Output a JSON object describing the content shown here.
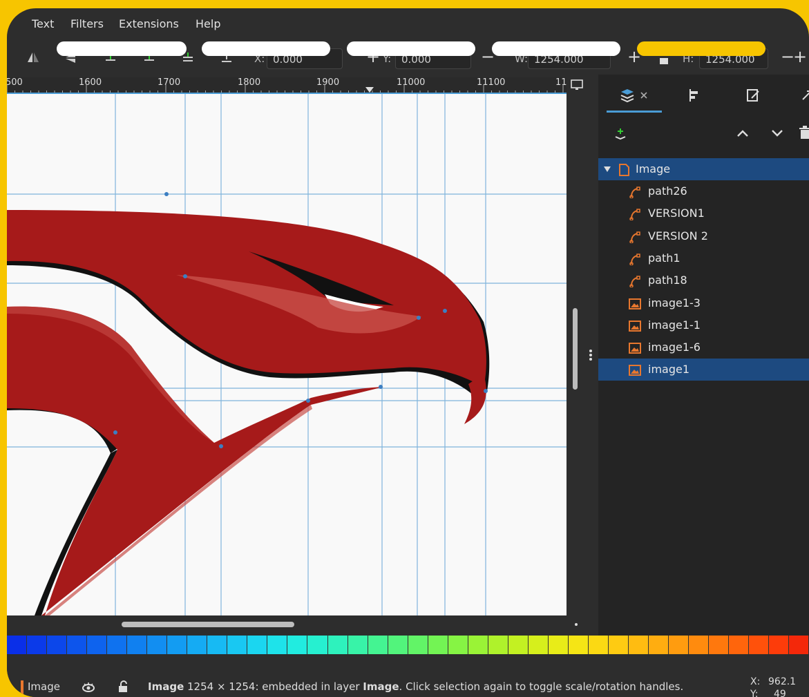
{
  "menu": {
    "items": [
      "Text",
      "Filters",
      "Extensions",
      "Help"
    ]
  },
  "toolbar": {
    "x_label": "X:",
    "x_value": "0.000",
    "y_label": "Y:",
    "y_value": "0.000",
    "w_label": "W:",
    "w_value": "1254.000",
    "h_label": "H:",
    "h_value": "1254.000",
    "minus": "−",
    "plus": "+"
  },
  "ruler": {
    "labels": [
      "500",
      "1600",
      "1700",
      "1800",
      "1900",
      "11000",
      "11100",
      "11"
    ]
  },
  "layers_panel": {
    "root": "Image",
    "items": [
      {
        "label": "path26",
        "kind": "path"
      },
      {
        "label": "VERSION1",
        "kind": "path"
      },
      {
        "label": "VERSION 2",
        "kind": "path"
      },
      {
        "label": "path1",
        "kind": "path"
      },
      {
        "label": "path18",
        "kind": "path"
      },
      {
        "label": "image1-3",
        "kind": "image"
      },
      {
        "label": "image1-1",
        "kind": "image"
      },
      {
        "label": "image1-6",
        "kind": "image"
      },
      {
        "label": "image1",
        "kind": "image",
        "selected": true
      }
    ]
  },
  "palette": [
    "#0a2fe8",
    "#0b3ae9",
    "#0c47ea",
    "#0d55ec",
    "#0e63ee",
    "#0f72ef",
    "#1080f0",
    "#128ef1",
    "#139cf2",
    "#15abf3",
    "#17baf3",
    "#19c8f2",
    "#1bd6f0",
    "#1ee3ea",
    "#21ece0",
    "#26f0d0",
    "#2ef2bd",
    "#38f3a8",
    "#44f492",
    "#52f47c",
    "#62f467",
    "#73f454",
    "#86f444",
    "#9af336",
    "#aff22b",
    "#c3f122",
    "#d6ef1c",
    "#e8ec18",
    "#f5e515",
    "#fbd913",
    "#fecb12",
    "#ffbc11",
    "#ffad10",
    "#ff9c0f",
    "#ff8b0e",
    "#ff780d",
    "#ff650c",
    "#ff510b",
    "#fd3c0a",
    "#f4280a"
  ],
  "status": {
    "layer": "Image",
    "message_bold": "Image",
    "message_1": " 1254 × 1254: embedded in layer ",
    "message_bold2": "Image",
    "message_2": ". Click selection again to toggle scale/rotation handles.",
    "x_label": "X:",
    "x_value": "962.1",
    "y_label": "Y:",
    "y_value": "49"
  },
  "colors": {
    "accent": "#f7c500",
    "selection": "#1d4a80",
    "guide": "#4a9cd6",
    "logo": "#a61a1a"
  }
}
